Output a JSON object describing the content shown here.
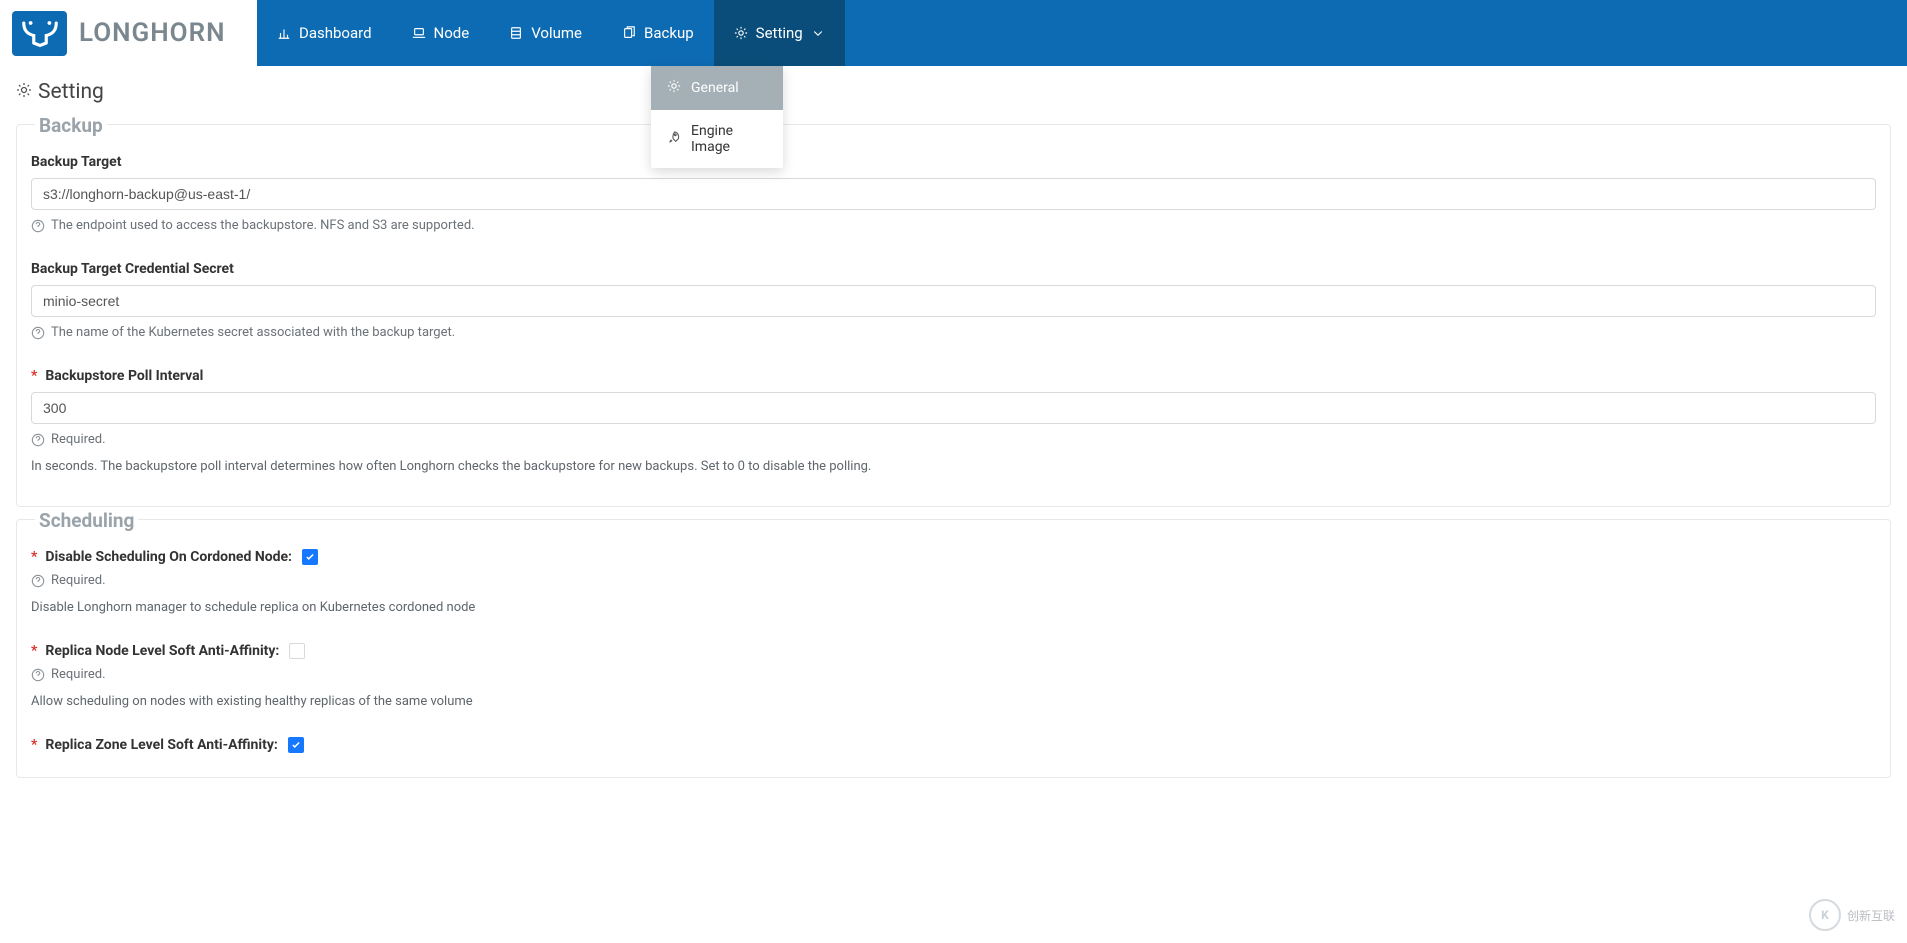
{
  "brand": {
    "name": "LONGHORN"
  },
  "nav": {
    "dashboard": "Dashboard",
    "node": "Node",
    "volume": "Volume",
    "backup": "Backup",
    "setting": "Setting",
    "dropdown": {
      "general": "General",
      "engine_image": "Engine Image"
    }
  },
  "page": {
    "title": "Setting"
  },
  "sections": {
    "backup": {
      "legend": "Backup",
      "target": {
        "label": "Backup Target",
        "value": "s3://longhorn-backup@us-east-1/",
        "help": "The endpoint used to access the backupstore. NFS and S3 are supported."
      },
      "secret": {
        "label": "Backup Target Credential Secret",
        "value": "minio-secret",
        "help": "The name of the Kubernetes secret associated with the backup target."
      },
      "poll": {
        "label": "Backupstore Poll Interval",
        "value": "300",
        "required_text": "Required.",
        "desc": "In seconds. The backupstore poll interval determines how often Longhorn checks the backupstore for new backups. Set to 0 to disable the polling."
      }
    },
    "scheduling": {
      "legend": "Scheduling",
      "disable_cordoned": {
        "label": "Disable Scheduling On Cordoned Node:",
        "required_text": "Required.",
        "desc": "Disable Longhorn manager to schedule replica on Kubernetes cordoned node"
      },
      "node_anti": {
        "label": "Replica Node Level Soft Anti-Affinity:",
        "required_text": "Required.",
        "desc": "Allow scheduling on nodes with existing healthy replicas of the same volume"
      },
      "zone_anti": {
        "label": "Replica Zone Level Soft Anti-Affinity:"
      }
    }
  },
  "watermark": {
    "brand": "创新互联"
  }
}
